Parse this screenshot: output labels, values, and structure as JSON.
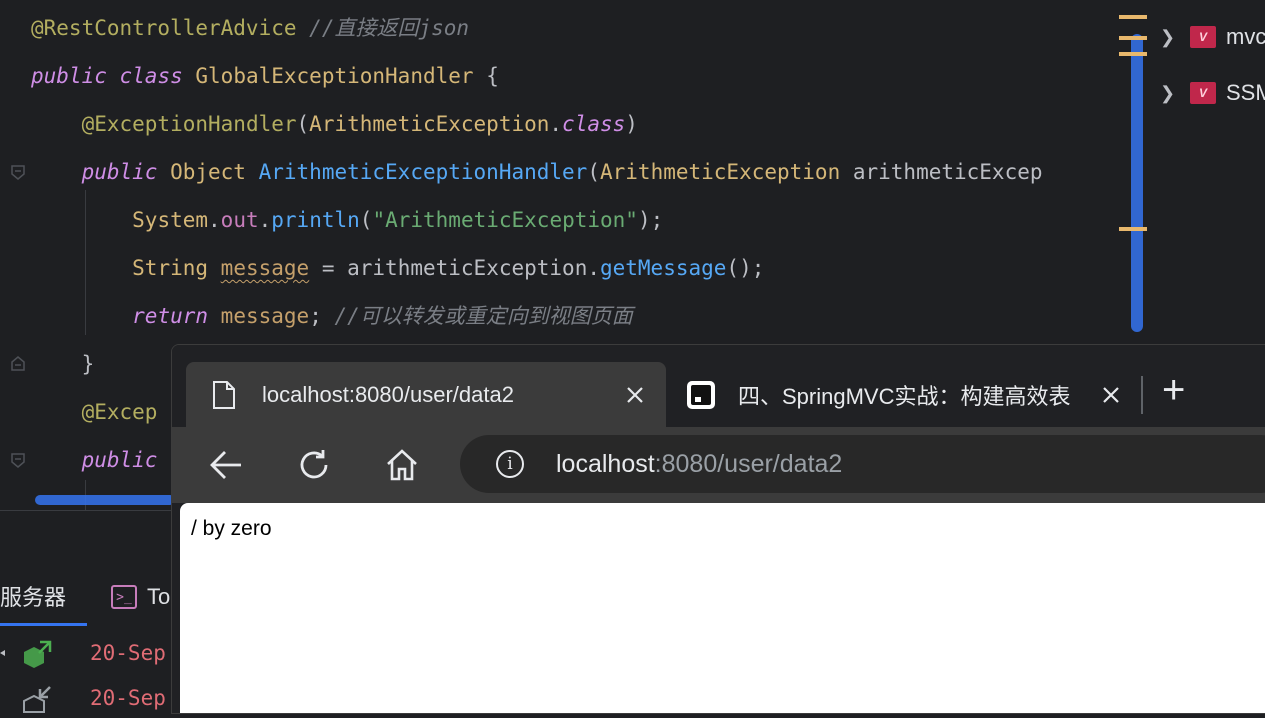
{
  "editor": {
    "lines": [
      {
        "parts": [
          [
            "ann",
            "@RestControllerAdvice"
          ],
          [
            "plain",
            " "
          ],
          [
            "cmt",
            "//直接返回json"
          ]
        ]
      },
      {
        "parts": [
          [
            "kw",
            "public"
          ],
          [
            "plain",
            " "
          ],
          [
            "kw",
            "class"
          ],
          [
            "plain",
            " "
          ],
          [
            "cls",
            "GlobalExceptionHandler"
          ],
          [
            "plain",
            " {"
          ]
        ]
      },
      {
        "parts": [
          [
            "plain",
            "    "
          ],
          [
            "ann",
            "@ExceptionHandler"
          ],
          [
            "plain",
            "("
          ],
          [
            "cls",
            "ArithmeticException"
          ],
          [
            "plain",
            "."
          ],
          [
            "kw",
            "class"
          ],
          [
            "plain",
            ")"
          ]
        ]
      },
      {
        "parts": [
          [
            "plain",
            "    "
          ],
          [
            "kw",
            "public"
          ],
          [
            "plain",
            " "
          ],
          [
            "cls",
            "Object"
          ],
          [
            "plain",
            " "
          ],
          [
            "fn",
            "ArithmeticExceptionHandler"
          ],
          [
            "plain",
            "("
          ],
          [
            "cls",
            "ArithmeticException"
          ],
          [
            "plain",
            " arithmeticExcep"
          ]
        ]
      },
      {
        "parts": [
          [
            "plain",
            "        "
          ],
          [
            "cls",
            "System"
          ],
          [
            "plain",
            "."
          ],
          [
            "fieldref",
            "out"
          ],
          [
            "plain",
            "."
          ],
          [
            "fn",
            "println"
          ],
          [
            "plain",
            "("
          ],
          [
            "str",
            "\"ArithmeticException\""
          ],
          [
            "plain",
            ");"
          ]
        ]
      },
      {
        "parts": [
          [
            "plain",
            "        "
          ],
          [
            "cls",
            "String"
          ],
          [
            "plain",
            " "
          ],
          [
            "localv wavy",
            "message"
          ],
          [
            "plain",
            " = arithmeticException."
          ],
          [
            "fn",
            "getMessage"
          ],
          [
            "plain",
            "();"
          ]
        ]
      },
      {
        "parts": [
          [
            "plain",
            "        "
          ],
          [
            "kw",
            "return"
          ],
          [
            "plain",
            " "
          ],
          [
            "localv",
            "message"
          ],
          [
            "plain",
            "; "
          ],
          [
            "cmt",
            "//可以转发或重定向到视图页面"
          ]
        ]
      },
      {
        "parts": [
          [
            "plain",
            "    }"
          ]
        ]
      },
      {
        "parts": [
          [
            "plain",
            "    "
          ],
          [
            "ann",
            "@Excep"
          ]
        ]
      },
      {
        "parts": [
          [
            "plain",
            "    "
          ],
          [
            "kw",
            "public"
          ]
        ]
      }
    ]
  },
  "project_tree": {
    "items": [
      {
        "label": "mvc",
        "icon": "module-icon"
      },
      {
        "label": "SSM",
        "icon": "module-icon"
      }
    ]
  },
  "bottom_panel": {
    "tabs": [
      {
        "label": "服务器",
        "active": true
      },
      {
        "label": "To",
        "icon": "terminal-icon"
      }
    ],
    "logs": [
      "20-Sep",
      "20-Sep"
    ]
  },
  "browser": {
    "tabs": [
      {
        "title": "localhost:8080/user/data2",
        "active": true,
        "icon": "page-icon"
      },
      {
        "title": "四、SpringMVC实战：构建高效表",
        "active": false,
        "icon": "site-icon"
      }
    ],
    "new_tab_label": "+",
    "address": {
      "host": "localhost",
      "rest": ":8080/user/data2"
    },
    "page_text": "/ by zero"
  }
}
